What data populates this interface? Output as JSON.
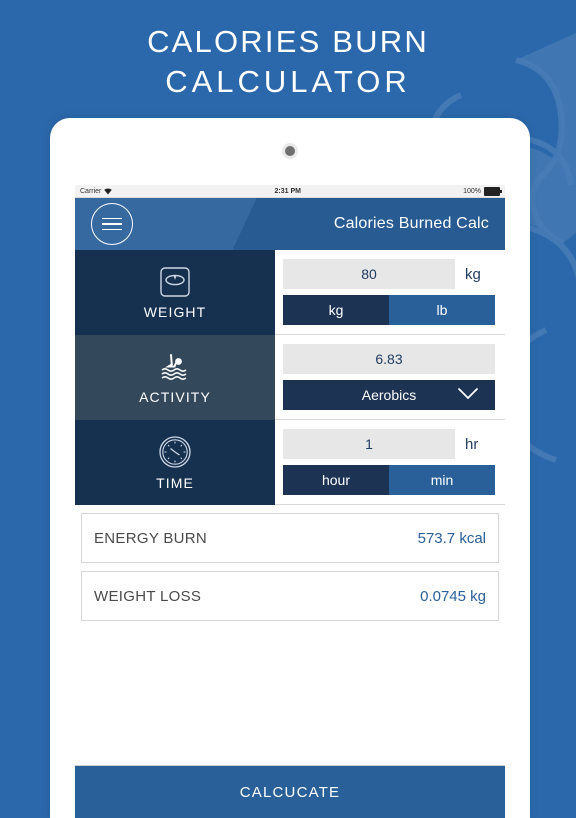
{
  "promo": {
    "line1": "CALORIES BURN",
    "line2": "CALCULATOR",
    "background_color": "#2b68ab"
  },
  "status_bar": {
    "carrier": "Carrier",
    "time": "2:31 PM",
    "battery": "100%"
  },
  "nav": {
    "title": "Calories Burned Calc",
    "menu_icon": "hamburger-menu-icon"
  },
  "rows": {
    "weight": {
      "label": "WEIGHT",
      "icon": "scale-icon",
      "value": "80",
      "unit": "kg",
      "toggle": {
        "left": "kg",
        "right": "lb",
        "selected": "kg"
      }
    },
    "activity": {
      "label": "ACTIVITY",
      "icon": "swimmer-icon",
      "value": "6.83",
      "selected_activity": "Aerobics",
      "chevron": "chevron-down-icon"
    },
    "time": {
      "label": "TIME",
      "icon": "clock-icon",
      "value": "1",
      "unit": "hr",
      "toggle": {
        "left": "hour",
        "right": "min",
        "selected": "hour"
      }
    }
  },
  "results": [
    {
      "label": "ENERGY BURN",
      "value": "573.7 kcal"
    },
    {
      "label": "WEIGHT LOSS",
      "value": "0.0745 kg"
    }
  ],
  "actions": {
    "calculate_label": "CALCUCATE"
  },
  "colors": {
    "brand_blue": "#2a6099",
    "dark_navy": "#16304f",
    "slate": "#34485c",
    "accent_value": "#2a6099"
  }
}
